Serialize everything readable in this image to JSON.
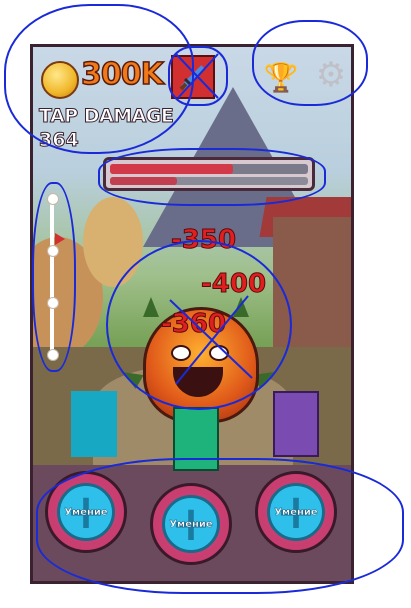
{
  "hud": {
    "gold": "300K",
    "tap_damage_label": "TAP DAMAGE",
    "tap_damage_value": "364"
  },
  "boss_hp": {
    "hp_fraction": 0.62,
    "timer_fraction": 0.34
  },
  "stage_progress": {
    "stops": 4,
    "current_stop": 1
  },
  "damage_numbers": [
    "-350",
    "-400",
    "-360"
  ],
  "abilities": [
    {
      "label": "Умение"
    },
    {
      "label": "Умение"
    },
    {
      "label": "Умение"
    }
  ],
  "colors": {
    "teal": "#17a9c4",
    "green": "#1db37a",
    "purple": "#7a4bb0",
    "hp": "#d23a4a",
    "annotation": "#1a2ad8"
  },
  "icons": [
    "coin-icon",
    "sword-icon",
    "trophy-icon",
    "gear-icon",
    "plus-icon"
  ]
}
